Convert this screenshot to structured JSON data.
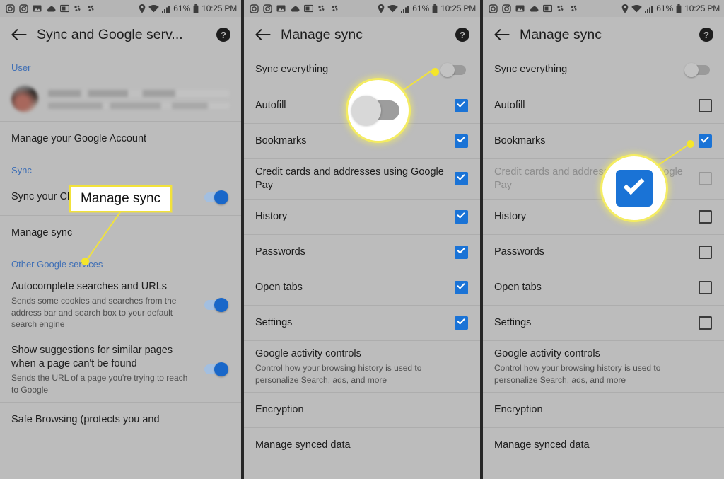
{
  "status_bar": {
    "icons": [
      "screenshot-icon",
      "instagram-icon",
      "image-icon",
      "cloud-icon",
      "media-icon",
      "cast-icon",
      "cast-icon-2"
    ],
    "location_icon": "location-pin-icon",
    "wifi_icon": "wifi-icon",
    "signal_icon": "signal-bars-icon",
    "battery_percent": "61%",
    "battery_icon": "battery-icon",
    "time": "10:25 PM"
  },
  "colors": {
    "accent_blue": "#1a73d6",
    "toggle_on": "#1967c9",
    "link_blue": "#3f6fb5",
    "highlight_yellow": "#f5e62a",
    "panel_bg": "#bcbcbc"
  },
  "panel1": {
    "title": "Sync and Google serv...",
    "back_label": "Back",
    "help_label": "Help",
    "section_user": "User",
    "manage_account": "Manage your Google Account",
    "section_sync": "Sync",
    "sync_chrome_data": "Sync your Chrome data",
    "sync_chrome_data_state": "on",
    "manage_sync": "Manage sync",
    "section_other": "Other Google services",
    "autocomplete_title": "Autocomplete searches and URLs",
    "autocomplete_sub": "Sends some cookies and searches from the address bar and search box to your default search engine",
    "autocomplete_state": "on",
    "suggestions_title": "Show suggestions for similar pages when a page can't be found",
    "suggestions_sub": "Sends the URL of a page you're trying to reach to Google",
    "suggestions_state": "on",
    "safe_browsing_title": "Safe Browsing (protects you and",
    "callout_label": "Manage sync"
  },
  "panel2": {
    "title": "Manage sync",
    "sync_everything": "Sync everything",
    "sync_everything_state": "off",
    "items": [
      {
        "label": "Autofill",
        "checked": true
      },
      {
        "label": "Bookmarks",
        "checked": true
      },
      {
        "label": "Credit cards and addresses using Google Pay",
        "checked": true
      },
      {
        "label": "History",
        "checked": true
      },
      {
        "label": "Passwords",
        "checked": true
      },
      {
        "label": "Open tabs",
        "checked": true
      },
      {
        "label": "Settings",
        "checked": true
      }
    ],
    "activity_title": "Google activity controls",
    "activity_sub": "Control how your browsing history is used to personalize Search, ads, and more",
    "encryption": "Encryption",
    "manage_synced_data": "Manage synced data",
    "magnifier_shows": "sync-everything-toggle-off"
  },
  "panel3": {
    "title": "Manage sync",
    "sync_everything": "Sync everything",
    "sync_everything_state": "off",
    "items": [
      {
        "label": "Autofill",
        "checked": false,
        "disabled": false
      },
      {
        "label": "Bookmarks",
        "checked": true,
        "disabled": false
      },
      {
        "label": "Credit cards and addresses using Google Pay",
        "checked": false,
        "disabled": true
      },
      {
        "label": "History",
        "checked": false,
        "disabled": false
      },
      {
        "label": "Passwords",
        "checked": false,
        "disabled": false
      },
      {
        "label": "Open tabs",
        "checked": false,
        "disabled": false
      },
      {
        "label": "Settings",
        "checked": false,
        "disabled": false
      }
    ],
    "activity_title": "Google activity controls",
    "activity_sub": "Control how your browsing history is used to personalize Search, ads, and more",
    "encryption": "Encryption",
    "manage_synced_data": "Manage synced data",
    "magnifier_shows": "bookmarks-checkbox-checked"
  }
}
